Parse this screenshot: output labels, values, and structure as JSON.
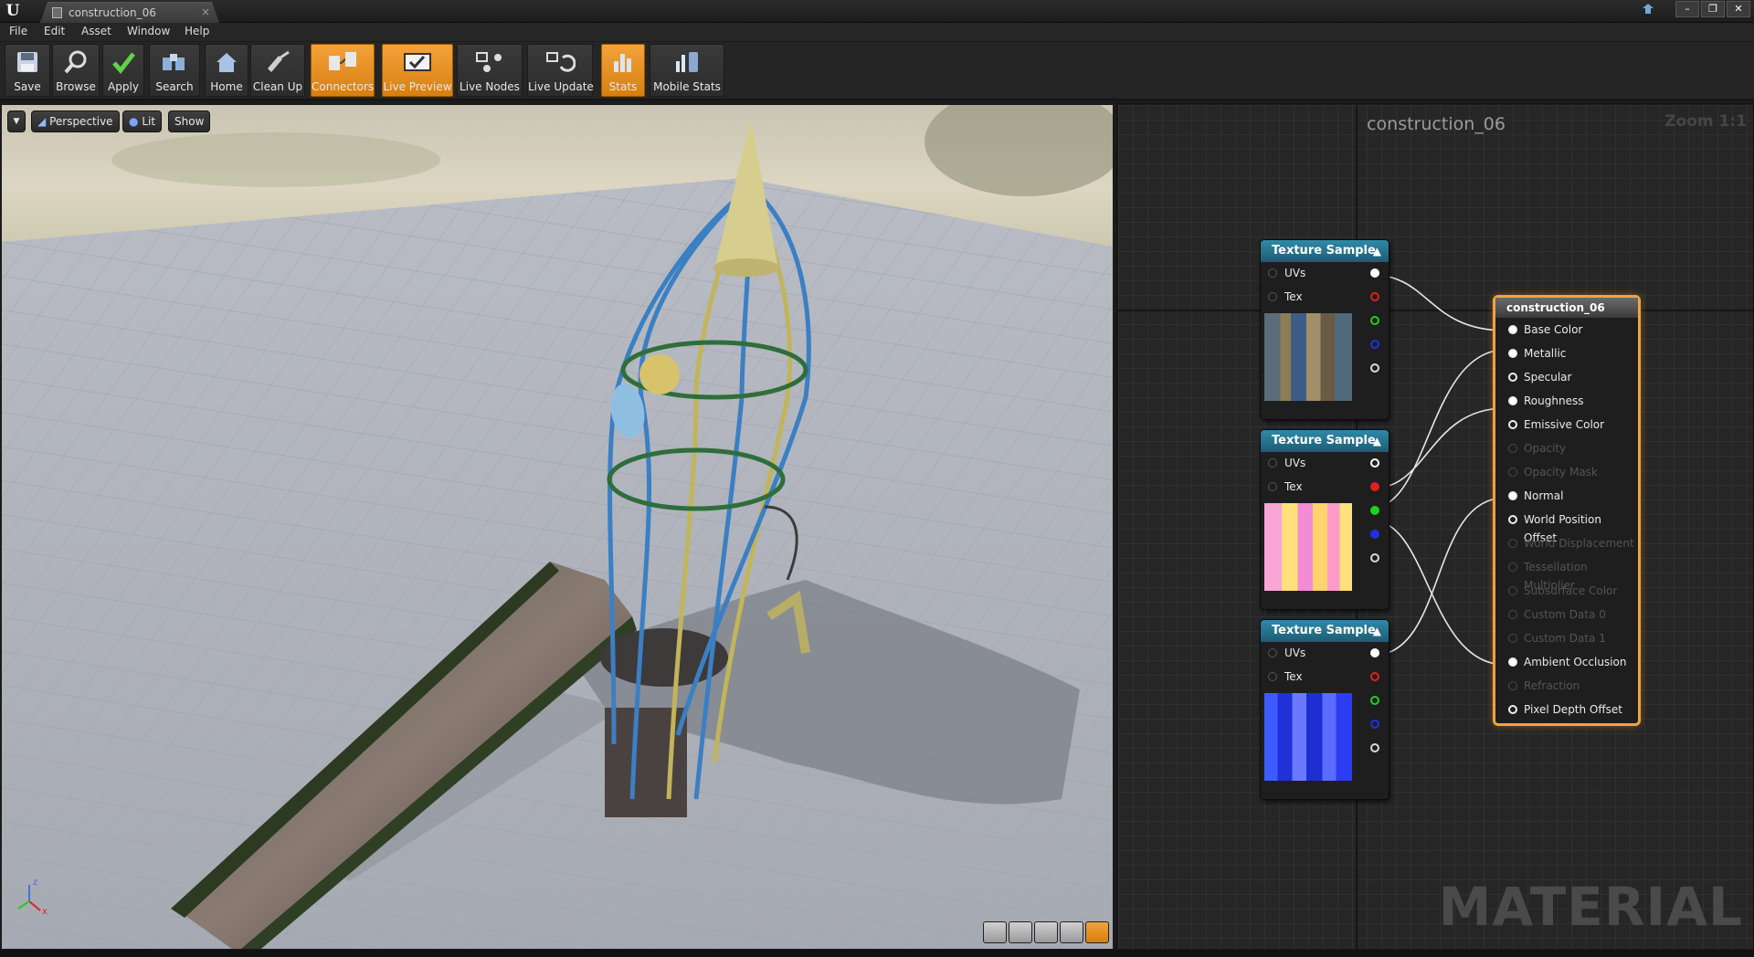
{
  "window": {
    "tab_title": "construction_06",
    "tab_close": "×",
    "buttons": [
      "–",
      "❐",
      "✕"
    ]
  },
  "menu": [
    "File",
    "Edit",
    "Asset",
    "Window",
    "Help"
  ],
  "toolbar": [
    {
      "label": "Save",
      "icon": "save-icon",
      "active": false
    },
    {
      "label": "Browse",
      "icon": "browse-icon",
      "active": false
    },
    {
      "label": "Apply",
      "icon": "apply-icon",
      "active": false
    },
    {
      "label": "Search",
      "icon": "search-icon",
      "active": false
    },
    {
      "label": "Home",
      "icon": "home-icon",
      "active": false
    },
    {
      "label": "Clean Up",
      "icon": "clean-up-icon",
      "active": false
    },
    {
      "label": "Connectors",
      "icon": "connectors-icon",
      "active": true
    },
    {
      "label": "Live Preview",
      "icon": "live-preview-icon",
      "active": true
    },
    {
      "label": "Live Nodes",
      "icon": "live-nodes-icon",
      "active": false
    },
    {
      "label": "Live Update",
      "icon": "live-update-icon",
      "active": false
    },
    {
      "label": "Stats",
      "icon": "stats-icon",
      "active": true
    },
    {
      "label": "Mobile Stats",
      "icon": "mobile-stats-icon",
      "active": false
    }
  ],
  "viewport": {
    "perspective_label": "Perspective",
    "lit_label": "Lit",
    "show_label": "Show",
    "axis_labels": {
      "z": "z",
      "x": "x"
    }
  },
  "graph": {
    "title": "construction_06",
    "zoom": "Zoom 1:1",
    "watermark": "MATERIAL",
    "texture_nodes": [
      {
        "title": "Texture Sample",
        "inputs": [
          "UVs",
          "Tex"
        ],
        "thumb": "base-color"
      },
      {
        "title": "Texture Sample",
        "inputs": [
          "UVs",
          "Tex"
        ],
        "thumb": "mask"
      },
      {
        "title": "Texture Sample",
        "inputs": [
          "UVs",
          "Tex"
        ],
        "thumb": "normal"
      }
    ],
    "output_pin_colors": [
      "#ffffff",
      "#e02020",
      "#20d020",
      "#2030e0",
      "#d8d8d8"
    ],
    "result_node": {
      "title": "construction_06",
      "inputs": [
        {
          "label": "Base Color",
          "enabled": true,
          "connected": true
        },
        {
          "label": "Metallic",
          "enabled": true,
          "connected": true
        },
        {
          "label": "Specular",
          "enabled": true,
          "connected": false
        },
        {
          "label": "Roughness",
          "enabled": true,
          "connected": true
        },
        {
          "label": "Emissive Color",
          "enabled": true,
          "connected": false
        },
        {
          "label": "Opacity",
          "enabled": false,
          "connected": false
        },
        {
          "label": "Opacity Mask",
          "enabled": false,
          "connected": false
        },
        {
          "label": "Normal",
          "enabled": true,
          "connected": true
        },
        {
          "label": "World Position Offset",
          "enabled": true,
          "connected": false
        },
        {
          "label": "World Displacement",
          "enabled": false,
          "connected": false
        },
        {
          "label": "Tessellation Multiplier",
          "enabled": false,
          "connected": false
        },
        {
          "label": "Subsurface Color",
          "enabled": false,
          "connected": false
        },
        {
          "label": "Custom Data 0",
          "enabled": false,
          "connected": false
        },
        {
          "label": "Custom Data 1",
          "enabled": false,
          "connected": false
        },
        {
          "label": "Ambient Occlusion",
          "enabled": true,
          "connected": true
        },
        {
          "label": "Refraction",
          "enabled": false,
          "connected": false
        },
        {
          "label": "Pixel Depth Offset",
          "enabled": true,
          "connected": false
        }
      ]
    }
  },
  "colors": {
    "accent": "#f3a23a",
    "node_header": "#2e8aa8",
    "background": "#262626"
  }
}
